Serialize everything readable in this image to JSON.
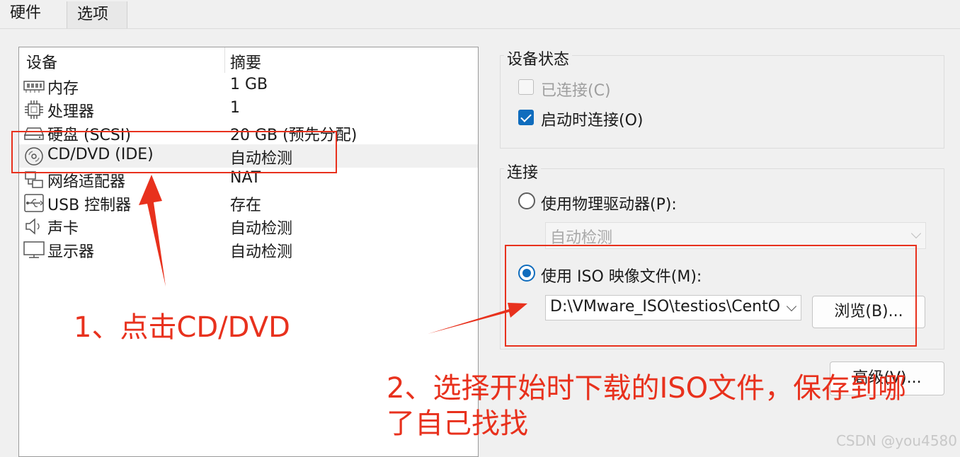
{
  "tabs": [
    {
      "label": "硬件"
    },
    {
      "label": "选项"
    }
  ],
  "devices": {
    "header": {
      "device": "设备",
      "summary": "摘要"
    },
    "rows": [
      {
        "icon": "memory-icon",
        "name": "内存",
        "summary": "1 GB"
      },
      {
        "icon": "processor-icon",
        "name": "处理器",
        "summary": "1"
      },
      {
        "icon": "harddisk-icon",
        "name": "硬盘 (SCSI)",
        "summary": "20 GB (预先分配)"
      },
      {
        "icon": "cd-dvd-icon",
        "name": "CD/DVD (IDE)",
        "summary": "自动检测"
      },
      {
        "icon": "network-adapter-icon",
        "name": "网络适配器",
        "summary": "NAT"
      },
      {
        "icon": "usb-icon",
        "name": "USB 控制器",
        "summary": "存在"
      },
      {
        "icon": "speaker-icon",
        "name": "声卡",
        "summary": "自动检测"
      },
      {
        "icon": "monitor-icon",
        "name": "显示器",
        "summary": "自动检测"
      }
    ]
  },
  "device_status": {
    "title": "设备状态",
    "connected": {
      "label": "已连接(C)",
      "checked": false,
      "enabled": false
    },
    "connect_at_power_on": {
      "label": "启动时连接(O)",
      "checked": true
    }
  },
  "connection": {
    "title": "连接",
    "physical_drive": {
      "label": "使用物理驱动器(P):",
      "selected": false,
      "dropdown_value": "自动检测"
    },
    "iso_file": {
      "label": "使用 ISO 映像文件(M):",
      "selected": true,
      "path_value": "D:\\VMware_ISO\\testios\\CentO"
    },
    "browse_label": "浏览(B)..."
  },
  "advanced_button_label": "高级(V)...",
  "annotations": {
    "step1": "1、点击CD/DVD",
    "step2_line1": "2、选择开始时下载的ISO文件，保存到哪",
    "step2_line2": "了自己找找"
  },
  "watermark": "CSDN @you4580",
  "colors": {
    "accent": "#0f6cbd",
    "annotation_red": "#e8311d"
  }
}
